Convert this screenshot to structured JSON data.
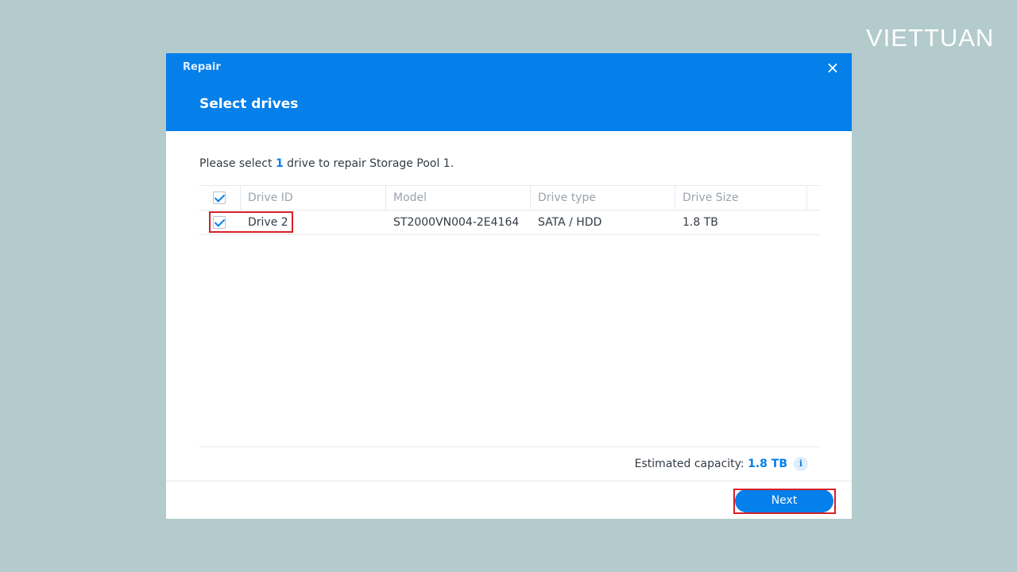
{
  "brand": {
    "logo_text": "VIETTUAN"
  },
  "dialog": {
    "window_title": "Repair",
    "step_title": "Select drives",
    "close_icon": "×"
  },
  "instruction": {
    "prefix": "Please select ",
    "count": "1",
    "suffix": " drive to repair Storage Pool 1."
  },
  "table": {
    "columns": [
      "Drive ID",
      "Model",
      "Drive type",
      "Drive Size"
    ],
    "rows": [
      {
        "checked": true,
        "drive_id": "Drive 2",
        "model": "ST2000VN004-2E4164",
        "drive_type": "SATA / HDD",
        "drive_size": "1.8 TB"
      }
    ]
  },
  "capacity": {
    "label": "Estimated capacity: ",
    "value": "1.8 TB",
    "info_icon": "i"
  },
  "footer": {
    "next_label": "Next"
  },
  "colors": {
    "accent": "#057fe9",
    "background": "#b3cbcc",
    "highlight": "#d52027"
  }
}
